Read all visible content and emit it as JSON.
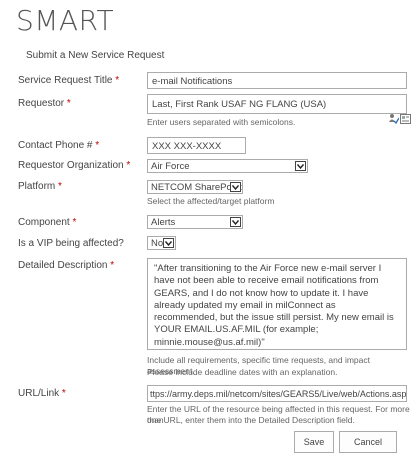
{
  "app": {
    "title": "SMART",
    "subtitle": "Submit a New Service Request"
  },
  "form": {
    "title_field": {
      "label": "Service Request Title",
      "required_mark": "*",
      "value": "e-mail Notifications"
    },
    "requestor": {
      "label": "Requestor",
      "required_mark": "*",
      "value": "Last, First Rank USAF NG FLANG (USA)",
      "hint": "Enter users separated with semicolons.",
      "icons": [
        "check-names-icon",
        "browse-address-book-icon"
      ]
    },
    "contact_phone": {
      "label": "Contact Phone #",
      "required_mark": "*",
      "value": "XXX XXX-XXXX"
    },
    "requestor_org": {
      "label": "Requestor Organization",
      "required_mark": "*",
      "value": "Air Force"
    },
    "platform": {
      "label": "Platform",
      "required_mark": "*",
      "value": "NETCOM SharePoint",
      "hint": "Select the affected/target platform"
    },
    "component": {
      "label": "Component",
      "required_mark": "*",
      "value": "Alerts"
    },
    "vip": {
      "label": "Is a VIP being affected?",
      "value": "No"
    },
    "description": {
      "label": "Detailed Description",
      "required_mark": "*",
      "value": "\"After transitioning to the Air Force new e-mail server I have not been able to receive email notifications from GEARS, and I do not know how to update it. I have already updated my email in milConnect as recommended, but the issue still persist. My new email is YOUR EMAIL.US.AF.MIL (for example; minnie.mouse@us.af.mil)\"",
      "hint_line1": "Include all requirements, specific time requests, and impact assessment.",
      "hint_line2": "Please include deadline dates with an explanation."
    },
    "url_link": {
      "label": "URL/Link",
      "required_mark": "*",
      "value": "ttps://army.deps.mil/netcom/sites/GEARS5/Live/web/Actions.aspx)",
      "hint_line1": "Enter the URL of the resource being affected in this request. For more than",
      "hint_line2": "one URL, enter them into the Detailed Description field."
    }
  },
  "buttons": {
    "save": "Save",
    "cancel": "Cancel"
  },
  "colors": {
    "required": "#c00000",
    "border": "#ababab",
    "text": "#444444"
  }
}
